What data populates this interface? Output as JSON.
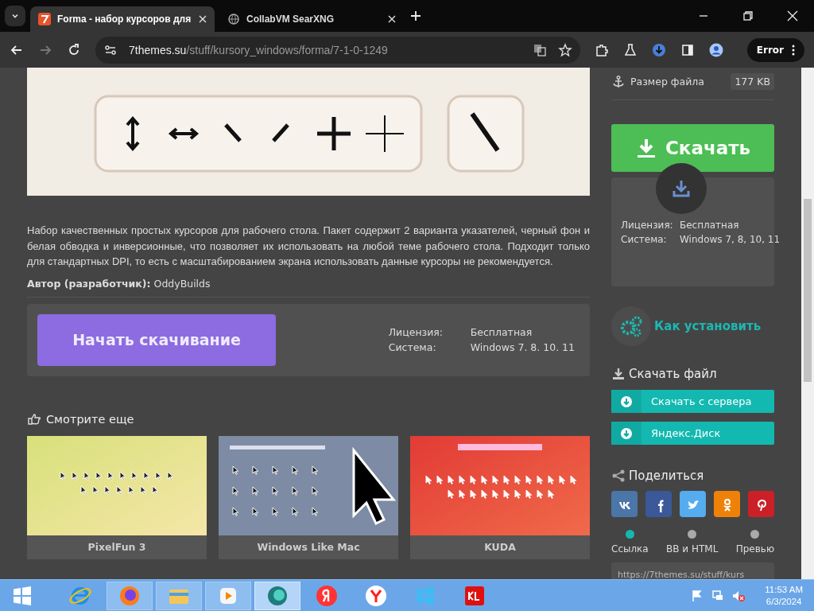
{
  "browser": {
    "tabs": [
      {
        "title": "Forma - набор курсоров для",
        "selected": true
      },
      {
        "title": "CollabVM SearXNG",
        "selected": false
      }
    ],
    "address": {
      "domain": "7themes.su",
      "path": "/stuff/kursory_windows/forma/7-1-0-1249"
    },
    "profile_button": "Error"
  },
  "article": {
    "description": "Набор качественных простых курсоров для рабочего стола. Пакет содержит 2 варианта указателей, черный фон и белая обводка и инверсионные, что позволяет их использовать на любой теме рабочего стола. Подходит только для стандартных DPI, то есть с масштабированием экрана использовать данные курсоры не рекомендуется.",
    "author_label": "Автор (разработчик):",
    "author": "OddyBuilds",
    "download_panel": {
      "button": "Начать скачивание",
      "info": [
        {
          "label": "Лицензия:",
          "value": "Бесплатная"
        },
        {
          "label": "Система:",
          "value": "Windows 7. 8. 10. 11"
        }
      ]
    },
    "see_also": {
      "title": "Смотрите еще",
      "items": [
        {
          "caption": "PixelFun 3",
          "kind": "light"
        },
        {
          "caption": "Windows Like Mac",
          "kind": "mac"
        },
        {
          "caption": "KUDA",
          "kind": "red"
        }
      ]
    }
  },
  "sidebar": {
    "file_size": {
      "label": "Размер файла",
      "value": "177 KB"
    },
    "download_button": "Скачать",
    "info": [
      {
        "label": "Лицензия:",
        "value": "Бесплатная"
      },
      {
        "label": "Система:",
        "value": "Windows 7, 8, 10, 11"
      }
    ],
    "how_to_install": "Как установить",
    "download_file": {
      "title": "Скачать файл",
      "buttons": [
        "Скачать с сервера",
        "Яндекс.Диск"
      ]
    },
    "share": {
      "title": "Поделиться",
      "networks": [
        {
          "kind": "vk"
        },
        {
          "kind": "facebook"
        },
        {
          "kind": "twitter"
        },
        {
          "kind": "ok"
        },
        {
          "kind": "pinterest"
        }
      ],
      "tabs": [
        {
          "label": "Ссылка",
          "selected": true
        },
        {
          "label": "BB и HTML",
          "selected": false
        },
        {
          "label": "Превью",
          "selected": false
        }
      ],
      "link_field": {
        "value": "https://7themes.su/stuff/kurs"
      }
    }
  },
  "taskbar": {
    "apps": [
      {
        "kind": "ie",
        "selected": false
      },
      {
        "kind": "firefox",
        "selected": false
      },
      {
        "kind": "explorer",
        "selected": false
      },
      {
        "kind": "media",
        "selected": false
      },
      {
        "kind": "chat",
        "selected": true
      },
      {
        "kind": "yandex",
        "selected": false
      },
      {
        "kind": "ybrowser",
        "selected": false
      },
      {
        "kind": "windows",
        "selected": false
      },
      {
        "kind": "kl",
        "selected": false
      }
    ],
    "clock": {
      "time": "11:53 AM",
      "date": "6/3/2024"
    }
  }
}
